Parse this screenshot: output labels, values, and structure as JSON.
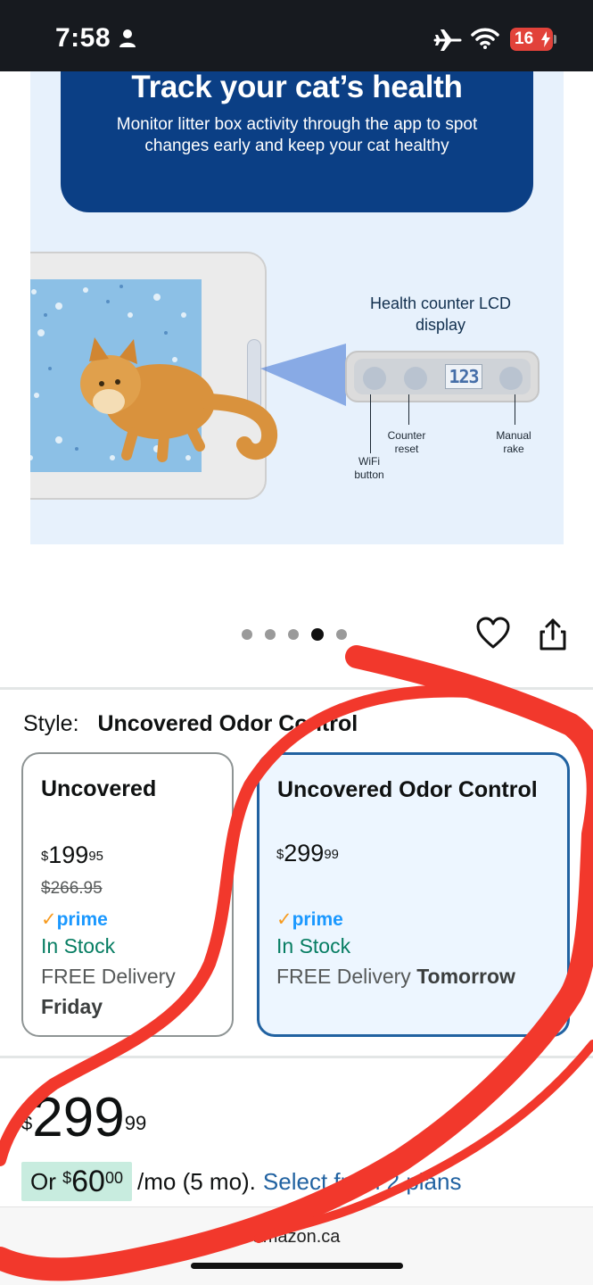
{
  "status_bar": {
    "time": "7:58",
    "battery": "16",
    "icons": [
      "person-icon",
      "airplane-icon",
      "wifi-icon",
      "charging-bolt-icon"
    ]
  },
  "product_image": {
    "banner_title": "Track your cat’s health",
    "banner_text": "Monitor litter box activity through the app to spot changes early and keep your cat healthy",
    "callout_title": "Health counter LCD display",
    "lcd_value": "123",
    "labels": {
      "counter_reset": "Counter reset",
      "manual_rake": "Manual rake",
      "wifi_button": "WiFi button"
    }
  },
  "carousel": {
    "dot_count": 5,
    "active_index": 3
  },
  "actions": {
    "icons": [
      "heart-icon",
      "share-icon"
    ]
  },
  "style_selector": {
    "label": "Style:",
    "selected": "Uncovered Odor Control",
    "options": [
      {
        "name": "Uncovered",
        "currency": "$",
        "price_whole": "199",
        "price_cents": "95",
        "list_price": "$266.95",
        "prime": "prime",
        "stock": "In Stock",
        "delivery_text": "FREE Delivery",
        "delivery_day": "Friday",
        "selected": false
      },
      {
        "name": "Uncovered Odor Control",
        "currency": "$",
        "price_whole": "299",
        "price_cents": "99",
        "prime": "prime",
        "stock": "In Stock",
        "delivery_text": "FREE Delivery",
        "delivery_day": "Tomorrow",
        "selected": true
      }
    ]
  },
  "price": {
    "currency": "$",
    "whole": "299",
    "cents": "99"
  },
  "installment": {
    "prefix": "Or",
    "currency": "$",
    "amount_whole": "60",
    "amount_cents": "00",
    "term": "/mo (5 mo).",
    "link": "Select from 2 plans"
  },
  "browser": {
    "url": "amazon.ca"
  },
  "colors": {
    "status_bar": "#171a1f",
    "banner": "#0b3f85",
    "selected_border": "#2162a1",
    "selected_bg": "#edf6ff",
    "in_stock": "#067d62",
    "prime": "#1a98ff",
    "installment_pill": "#c8ecdf",
    "link": "#2162a1",
    "annotation_scribble": "#f2382c"
  }
}
